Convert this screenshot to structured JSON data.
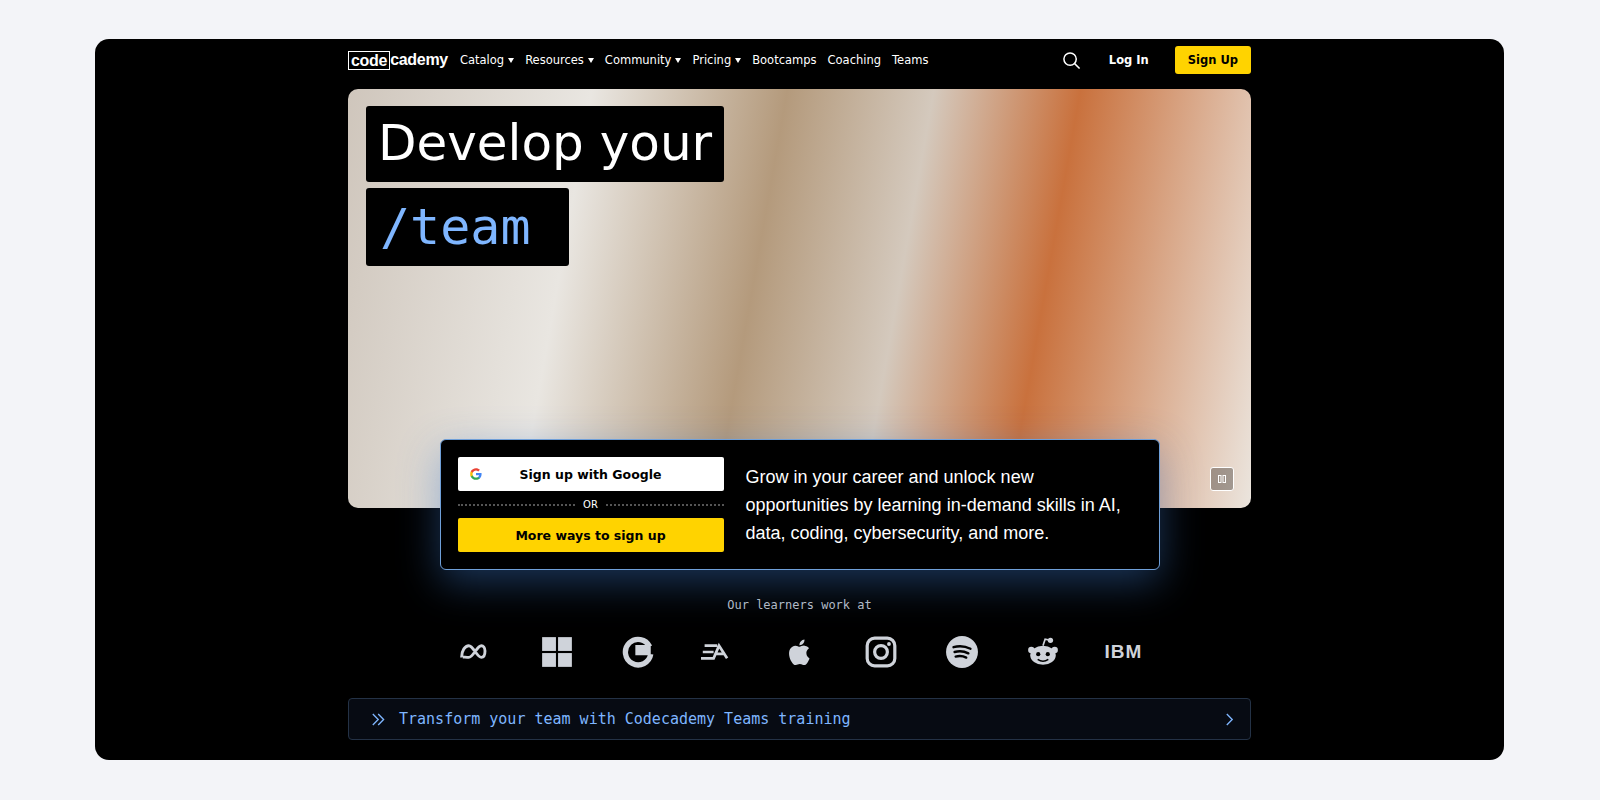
{
  "logo": {
    "boxed": "code",
    "rest": "cademy"
  },
  "nav": [
    {
      "label": "Catalog",
      "dropdown": true
    },
    {
      "label": "Resources",
      "dropdown": true
    },
    {
      "label": "Community",
      "dropdown": true
    },
    {
      "label": "Pricing",
      "dropdown": true
    },
    {
      "label": "Bootcamps",
      "dropdown": false
    },
    {
      "label": "Coaching",
      "dropdown": false
    },
    {
      "label": "Teams",
      "dropdown": false
    }
  ],
  "login": "Log In",
  "signup": "Sign Up",
  "hero": {
    "line1": "Develop your",
    "line2": "/team"
  },
  "card": {
    "google": "Sign up with Google",
    "or": "OR",
    "more": "More ways to sign up",
    "text": "Grow in your career and unlock new opportunities by learning in-demand skills in AI, data, coding, cybersecurity, and more."
  },
  "learners": "Our learners work at",
  "logos": [
    {
      "kind": "meta"
    },
    {
      "kind": "windows"
    },
    {
      "kind": "google"
    },
    {
      "kind": "ea"
    },
    {
      "kind": "apple"
    },
    {
      "kind": "instagram"
    },
    {
      "kind": "spotify"
    },
    {
      "kind": "reddit"
    },
    {
      "kind": "ibm",
      "text": "IBM"
    }
  ],
  "banner": "Transform your team with Codecademy Teams training"
}
